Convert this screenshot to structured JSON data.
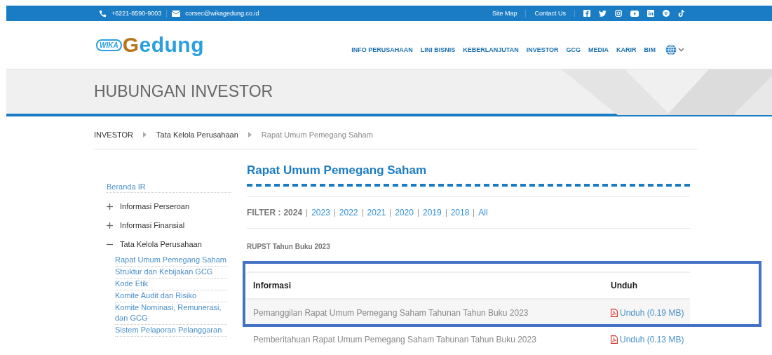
{
  "top_bar": {
    "phone": "+6221-8590-9003",
    "email": "corsec@wikagedung.co.id",
    "links": [
      "Site Map",
      "Contact Us"
    ]
  },
  "logo": {
    "badge": "WIKA",
    "name": "Gedung"
  },
  "nav": [
    "INFO PERUSAHAAN",
    "LINI BISNIS",
    "KEBERLANJUTAN",
    "INVESTOR",
    "GCG",
    "MEDIA",
    "KARIR",
    "BIM"
  ],
  "banner": {
    "title": "HUBUNGAN INVESTOR"
  },
  "breadcrumb": [
    {
      "label": "INVESTOR",
      "current": false
    },
    {
      "label": "Tata Kelola Perusahaan",
      "current": false
    },
    {
      "label": "Rapat Umum Pemegang Saham",
      "current": true
    }
  ],
  "sidebar": {
    "items": [
      {
        "label": "Beranda IR",
        "kind": "link"
      },
      {
        "label": "Informasi Perseroan",
        "kind": "group",
        "expanded": false
      },
      {
        "label": "Informasi Finansial",
        "kind": "group",
        "expanded": false
      },
      {
        "label": "Tata Kelola Perusahaan",
        "kind": "group",
        "expanded": true,
        "children": [
          {
            "label": "Rapat Umum Pemegang Saham"
          },
          {
            "label": "Struktur dan Kebijakan GCG"
          },
          {
            "label": "Kode Etik"
          },
          {
            "label": "Komite Audit dan Risiko"
          },
          {
            "label": "Komite Nominasi, Remunerasi, dan GCG"
          },
          {
            "label": "Sistem Pelaporan Pelanggaran"
          }
        ]
      }
    ]
  },
  "content": {
    "title": "Rapat Umum Pemegang Saham",
    "filter": {
      "label": "FILTER :",
      "years": [
        {
          "label": "2024",
          "selected": true
        },
        {
          "label": "2023",
          "selected": false
        },
        {
          "label": "2022",
          "selected": false
        },
        {
          "label": "2021",
          "selected": false
        },
        {
          "label": "2020",
          "selected": false
        },
        {
          "label": "2019",
          "selected": false
        },
        {
          "label": "2018",
          "selected": false
        },
        {
          "label": "All",
          "selected": false
        }
      ]
    },
    "section": "RUPST Tahun Buku 2023",
    "table": {
      "columns": [
        "Informasi",
        "Unduh"
      ],
      "header_framed": true,
      "rows": [
        {
          "info": "Pemanggilan Rapat Umum Pemegang Saham Tahunan Tahun Buku 2023",
          "download": "Unduh (0.19 MB)",
          "framed": true
        },
        {
          "info": "Pemberitahuan Rapat Umum Pemegang Saham Tahunan Tahun Buku 2023",
          "download": "Unduh (0.13 MB)",
          "framed": false
        }
      ]
    }
  }
}
